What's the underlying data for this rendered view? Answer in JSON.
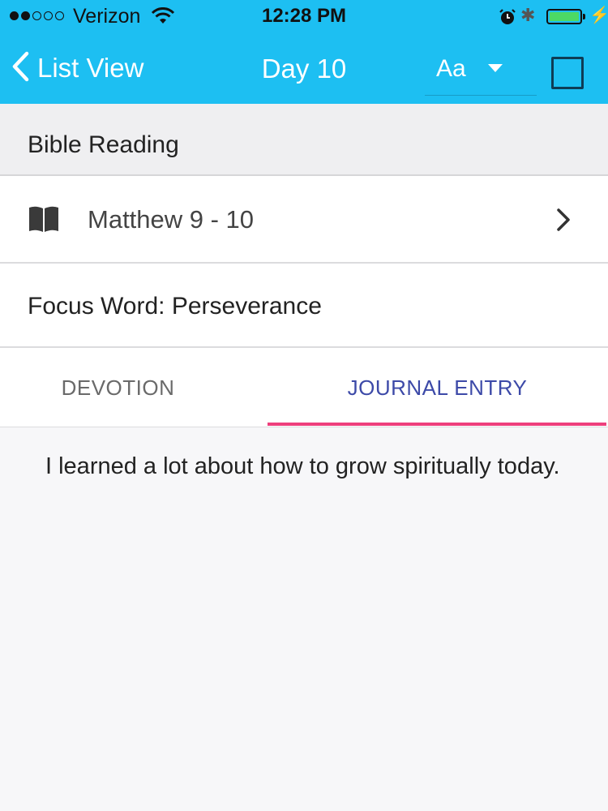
{
  "status_bar": {
    "carrier": "Verizon",
    "time": "12:28 PM",
    "signal_strength": 2,
    "battery_level": 1.0
  },
  "nav": {
    "back_label": "List View",
    "title": "Day 10",
    "font_button": "Aa"
  },
  "section": {
    "title": "Bible Reading"
  },
  "reading": {
    "passage": "Matthew 9 - 10"
  },
  "focus": {
    "text": "Focus Word: Perseverance"
  },
  "tabs": [
    {
      "label": "DEVOTION",
      "selected": false
    },
    {
      "label": "JOURNAL ENTRY",
      "selected": true
    }
  ],
  "journal": {
    "text": "I learned a lot about how to grow spiritually today."
  },
  "colors": {
    "header_bg": "#1dbff2",
    "tab_active_text": "#3d4aa8",
    "tab_indicator": "#ee3f7d",
    "battery": "#4cd964"
  },
  "icons": [
    "back-chevron-icon",
    "wifi-icon",
    "alarm-icon",
    "bluetooth-icon",
    "battery-icon",
    "charging-icon",
    "caret-down-icon",
    "book-icon",
    "chevron-right-icon"
  ]
}
